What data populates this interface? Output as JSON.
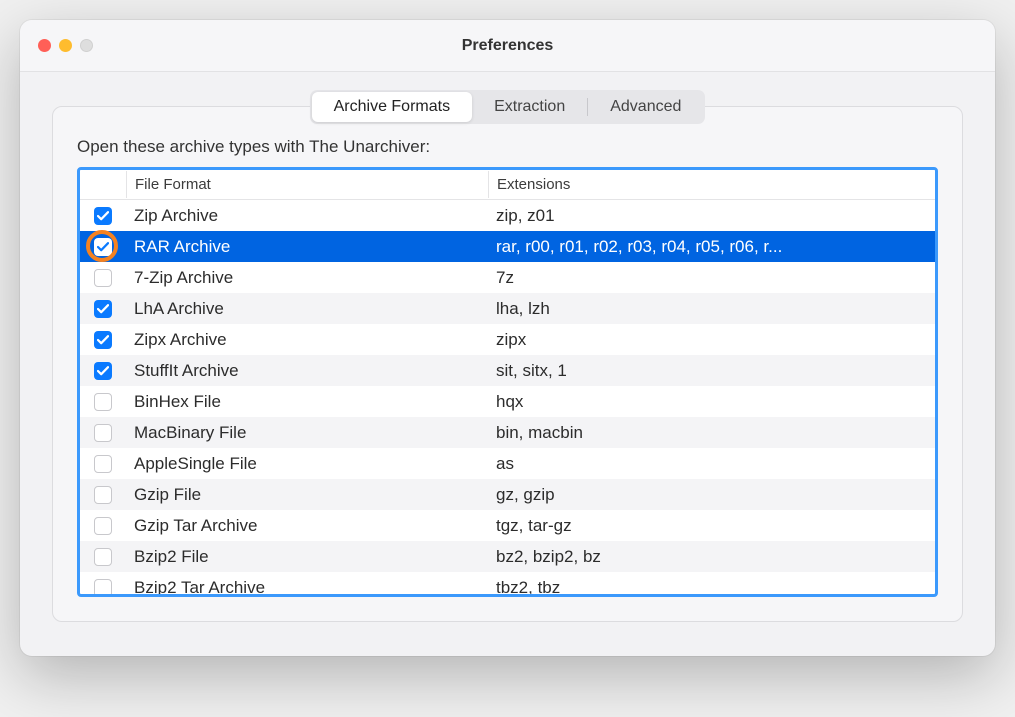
{
  "window": {
    "title": "Preferences"
  },
  "tabs": {
    "items": [
      {
        "label": "Archive Formats",
        "active": true
      },
      {
        "label": "Extraction",
        "active": false
      },
      {
        "label": "Advanced",
        "active": false
      }
    ]
  },
  "panel": {
    "heading": "Open these archive types with The Unarchiver:"
  },
  "table": {
    "headers": {
      "format": "File Format",
      "extensions": "Extensions"
    },
    "rows": [
      {
        "checked": true,
        "selected": false,
        "format": "Zip Archive",
        "extensions": "zip, z01"
      },
      {
        "checked": true,
        "selected": true,
        "highlighted": true,
        "format": "RAR Archive",
        "extensions": "rar, r00, r01, r02, r03, r04, r05, r06, r..."
      },
      {
        "checked": false,
        "selected": false,
        "format": "7-Zip Archive",
        "extensions": "7z"
      },
      {
        "checked": true,
        "selected": false,
        "format": "LhA Archive",
        "extensions": "lha, lzh"
      },
      {
        "checked": true,
        "selected": false,
        "format": "Zipx Archive",
        "extensions": "zipx"
      },
      {
        "checked": true,
        "selected": false,
        "format": "StuffIt Archive",
        "extensions": "sit, sitx, 1"
      },
      {
        "checked": false,
        "selected": false,
        "format": "BinHex File",
        "extensions": "hqx"
      },
      {
        "checked": false,
        "selected": false,
        "format": "MacBinary File",
        "extensions": "bin, macbin"
      },
      {
        "checked": false,
        "selected": false,
        "format": "AppleSingle File",
        "extensions": "as"
      },
      {
        "checked": false,
        "selected": false,
        "format": "Gzip File",
        "extensions": "gz, gzip"
      },
      {
        "checked": false,
        "selected": false,
        "format": "Gzip Tar Archive",
        "extensions": "tgz, tar-gz"
      },
      {
        "checked": false,
        "selected": false,
        "format": "Bzip2 File",
        "extensions": "bz2, bzip2, bz"
      },
      {
        "checked": false,
        "selected": false,
        "format": "Bzip2 Tar Archive",
        "extensions": "tbz2, tbz"
      }
    ]
  }
}
